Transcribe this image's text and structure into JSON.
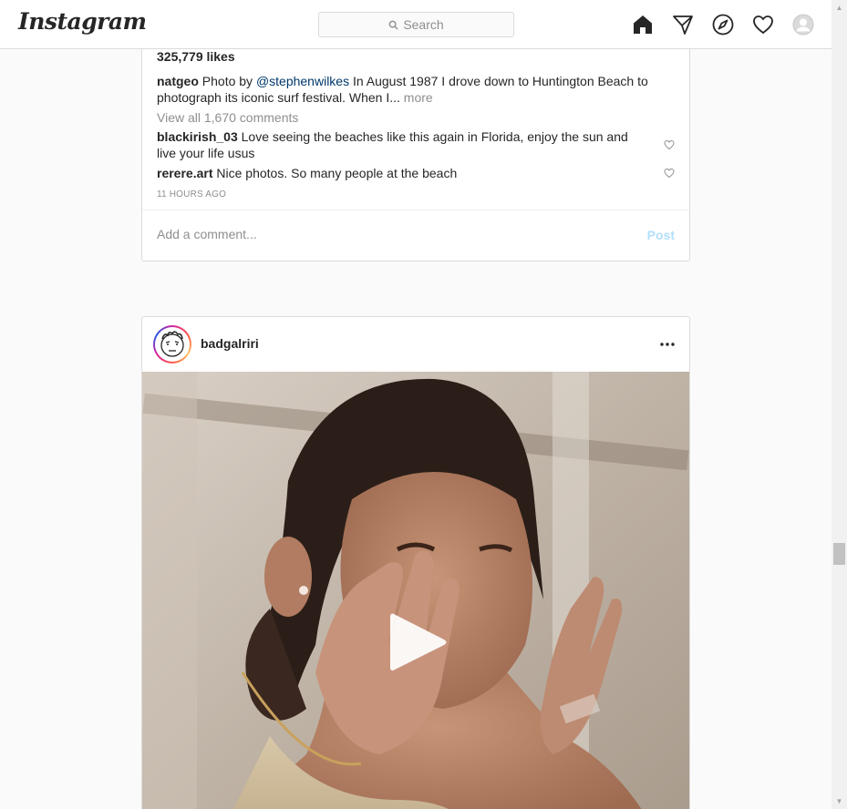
{
  "nav": {
    "logo": "Instagram",
    "search_placeholder": "Search",
    "icons": [
      "home-icon",
      "direct-icon",
      "explore-icon",
      "activity-heart-icon",
      "profile-avatar-icon"
    ]
  },
  "post1": {
    "likes": "325,779 likes",
    "caption": {
      "user": "natgeo",
      "text_before": " Photo by ",
      "mention": "@stephenwilkes",
      "text_after": " In August 1987 I drove down to Huntington Beach to photograph its iconic surf festival. When I... ",
      "more": "more"
    },
    "view_all": "View all 1,670 comments",
    "comments": [
      {
        "user": "blackirish_03",
        "text": " Love seeing the beaches like this again in Florida, enjoy the sun and live your life usus"
      },
      {
        "user": "rerere.art",
        "text": " Nice photos. So many people at the beach"
      }
    ],
    "timestamp": "11 HOURS AGO",
    "comment_placeholder": "Add a comment...",
    "post_label": "Post"
  },
  "post2": {
    "username": "badgalriri",
    "media_type": "video"
  },
  "colors": {
    "link": "#00376b",
    "muted": "#8e8e8e",
    "post_disabled": "#b2dffc",
    "border": "#dbdbdb"
  }
}
